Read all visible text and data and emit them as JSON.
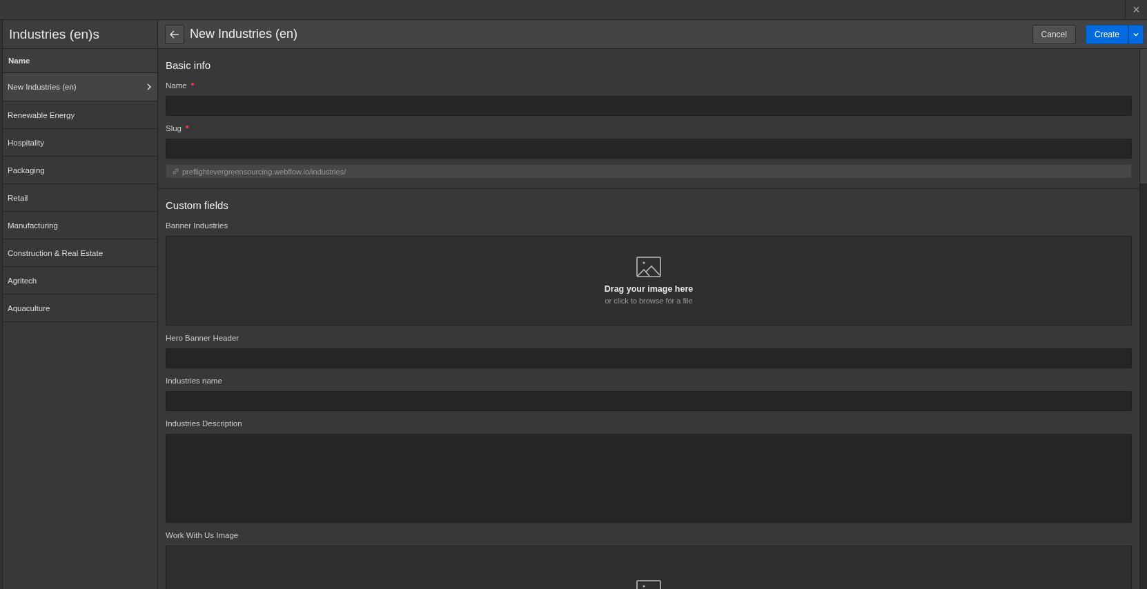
{
  "window": {
    "close": "×"
  },
  "sidebar": {
    "title": "Industries (en)s",
    "column": "Name",
    "items": [
      {
        "label": "New Industries (en)",
        "selected": true
      },
      {
        "label": "Renewable Energy",
        "selected": false
      },
      {
        "label": "Hospitality",
        "selected": false
      },
      {
        "label": "Packaging",
        "selected": false
      },
      {
        "label": "Retail",
        "selected": false
      },
      {
        "label": "Manufacturing",
        "selected": false
      },
      {
        "label": "Construction & Real Estate",
        "selected": false
      },
      {
        "label": "Agritech",
        "selected": false
      },
      {
        "label": "Aquaculture",
        "selected": false
      }
    ]
  },
  "editor": {
    "title": "New Industries (en)",
    "cancel": "Cancel",
    "create": "Create",
    "sections": [
      {
        "title": "Basic info",
        "fields": [
          {
            "kind": "text",
            "label": "Name",
            "required": true
          },
          {
            "kind": "text",
            "label": "Slug",
            "required": true,
            "url": "preflightevergreensourcing.webflow.io/industries/"
          }
        ]
      },
      {
        "title": "Custom fields",
        "fields": [
          {
            "kind": "image",
            "label": "Banner Industries",
            "hint": "Drag your image here",
            "subhint": "or click to browse for a file"
          },
          {
            "kind": "text",
            "label": "Hero Banner Header",
            "required": false
          },
          {
            "kind": "text",
            "label": "Industries name",
            "required": false
          },
          {
            "kind": "textarea",
            "label": "Industries Description",
            "required": false
          },
          {
            "kind": "image",
            "label": "Work With Us Image"
          }
        ]
      }
    ]
  }
}
